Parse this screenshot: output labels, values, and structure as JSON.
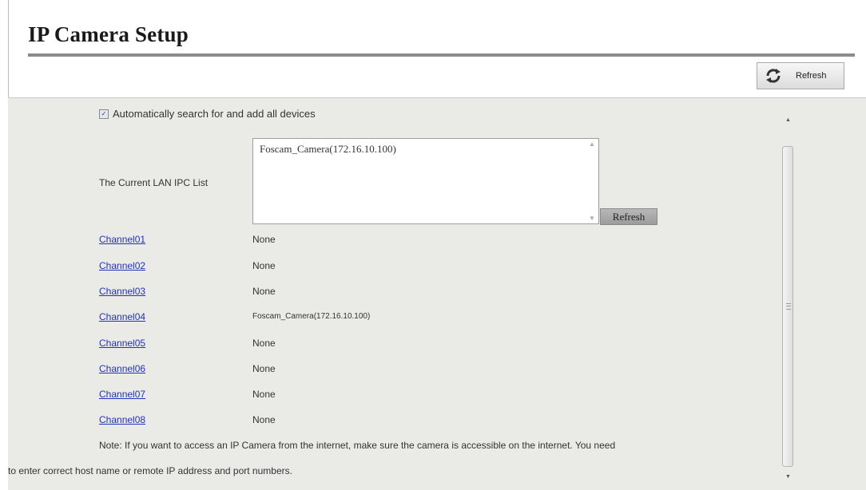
{
  "header": {
    "title": "IP Camera Setup",
    "refresh_label": "Refresh"
  },
  "auto_search": {
    "label": "Automatically search for and add all devices",
    "checked": true
  },
  "lan_list": {
    "label": "The Current LAN IPC List",
    "items": [
      "Foscam_Camera(172.16.10.100)"
    ],
    "refresh_label": "Refresh"
  },
  "channels": [
    {
      "name": "Channel01",
      "value": "None"
    },
    {
      "name": "Channel02",
      "value": "None"
    },
    {
      "name": "Channel03",
      "value": "None"
    },
    {
      "name": "Channel04",
      "value": "Foscam_Camera(172.16.10.100)"
    },
    {
      "name": "Channel05",
      "value": "None"
    },
    {
      "name": "Channel06",
      "value": "None"
    },
    {
      "name": "Channel07",
      "value": "None"
    },
    {
      "name": "Channel08",
      "value": "None"
    }
  ],
  "note": {
    "line1": "Note: If you want to access an IP Camera from the internet, make sure the camera is accessible on the internet. You need",
    "line2": "to enter correct host name or remote IP address and port numbers."
  },
  "colors": {
    "link": "#2233bb",
    "panel_bg": "#eaeae6",
    "rule": "#8c8c8c"
  }
}
